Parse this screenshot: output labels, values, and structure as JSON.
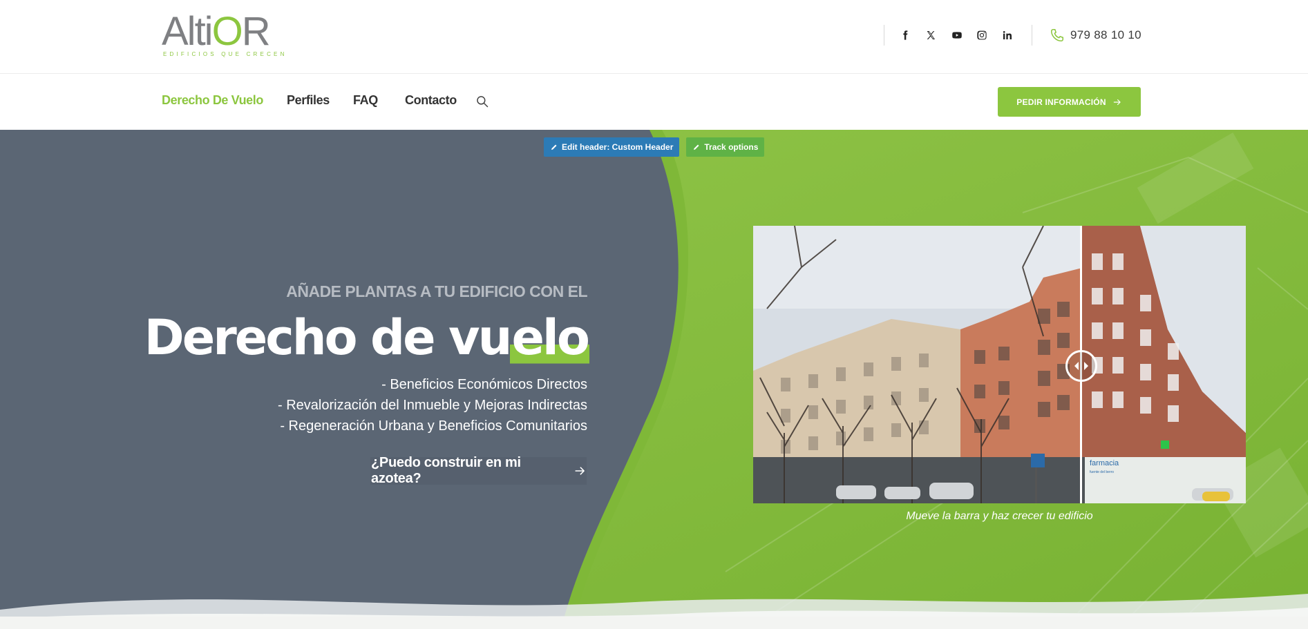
{
  "brand": {
    "logo_text_a": "Alti",
    "logo_text_b": "O",
    "logo_text_c": "R",
    "tagline": "EDIFICIOS QUE CRECEN",
    "accent_color": "#8cc63f",
    "dark_color": "#5b6674"
  },
  "social": [
    {
      "name": "facebook-icon"
    },
    {
      "name": "x-twitter-icon"
    },
    {
      "name": "youtube-icon"
    },
    {
      "name": "instagram-icon"
    },
    {
      "name": "linkedin-icon"
    }
  ],
  "contact": {
    "phone": "979 88 10 10"
  },
  "nav": {
    "items": [
      "Derecho De Vuelo",
      "Perfiles",
      "FAQ",
      "Contacto"
    ],
    "active_index": 0,
    "cta_label": "PEDIR INFORMACIÓN"
  },
  "admin_badges": {
    "edit_header": "Edit header: Custom Header",
    "track_options": "Track options"
  },
  "hero": {
    "eyebrow": "AÑADE PLANTAS A TU EDIFICIO CON EL",
    "headline_main": "Derecho de vu",
    "headline_highlight": "elo",
    "benefits": [
      "- Beneficios Económicos Directos",
      "- Revalorización del Inmueble y Mejoras Indirectas",
      "- Regeneración Urbana y Beneficios Comunitarios"
    ],
    "link_label": "¿Puedo construir en mi azotea?",
    "slider_caption": "Mueve la barra y haz crecer tu edificio",
    "slider_position": 0.665
  },
  "photo": {
    "shop_sign": "farmacia",
    "shop_sign_sub": "fuente del berro"
  }
}
